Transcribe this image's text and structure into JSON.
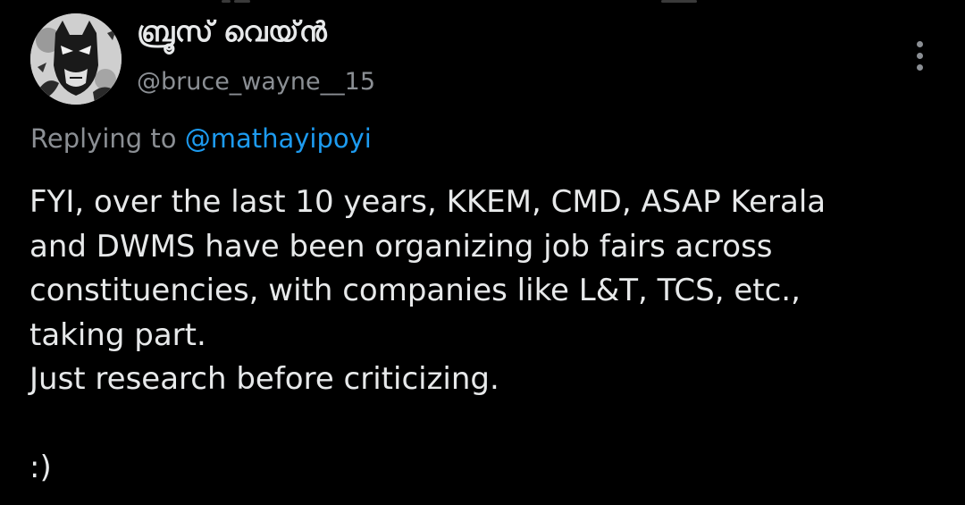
{
  "tweet": {
    "author": {
      "display_name": "ബ്രൂസ് വെയ്ൻ",
      "handle": "@bruce_wayne__15",
      "avatar_icon": "batman-avatar-icon"
    },
    "reply_context": {
      "prefix": "Replying to",
      "mention": "@mathayipoyi"
    },
    "body_lines": [
      "FYI, over the last 10 years, KKEM, CMD, ASAP Kerala",
      "and DWMS  have been organizing job fairs across",
      "constituencies, with companies like L&T, TCS, etc.,",
      "taking part.",
      "Just research before criticizing.",
      "",
      ":)"
    ],
    "more_icon": "more-vertical-icon"
  },
  "colors": {
    "background": "#000000",
    "primary_text": "#e7e9ea",
    "secondary_text": "#8b8f94",
    "link": "#1d9bf0"
  }
}
